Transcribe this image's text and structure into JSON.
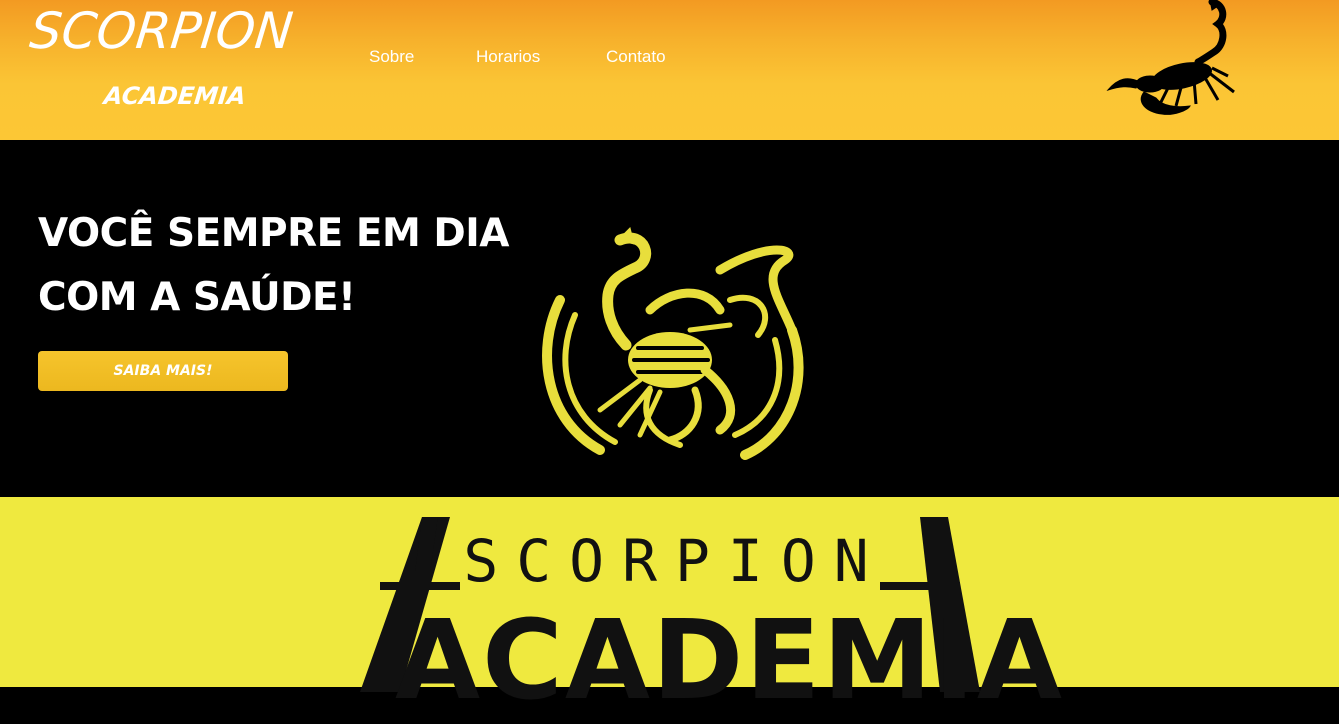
{
  "brand": {
    "title": "SCORPION",
    "subtitle": "ACADEMIA"
  },
  "nav": {
    "items": [
      "Sobre",
      "Horarios",
      "Contato"
    ]
  },
  "hero": {
    "title_line1": "VOCÊ SEMPRE EM DIA",
    "title_line2": "COM A SAÚDE!",
    "cta_label": "SAIBA MAIS!"
  },
  "banner": {
    "line1": "SCORPION",
    "line2": "ACADEMIA"
  },
  "colors": {
    "header_top": "#f39a22",
    "header_bottom": "#fcc735",
    "hero_bg": "#000000",
    "cta": "#f2bf27",
    "emblem": "#e8de3c",
    "banner_bg": "#efe93f"
  },
  "icons": {
    "header_icon": "scorpion-icon",
    "hero_emblem": "scorpion-emblem"
  }
}
